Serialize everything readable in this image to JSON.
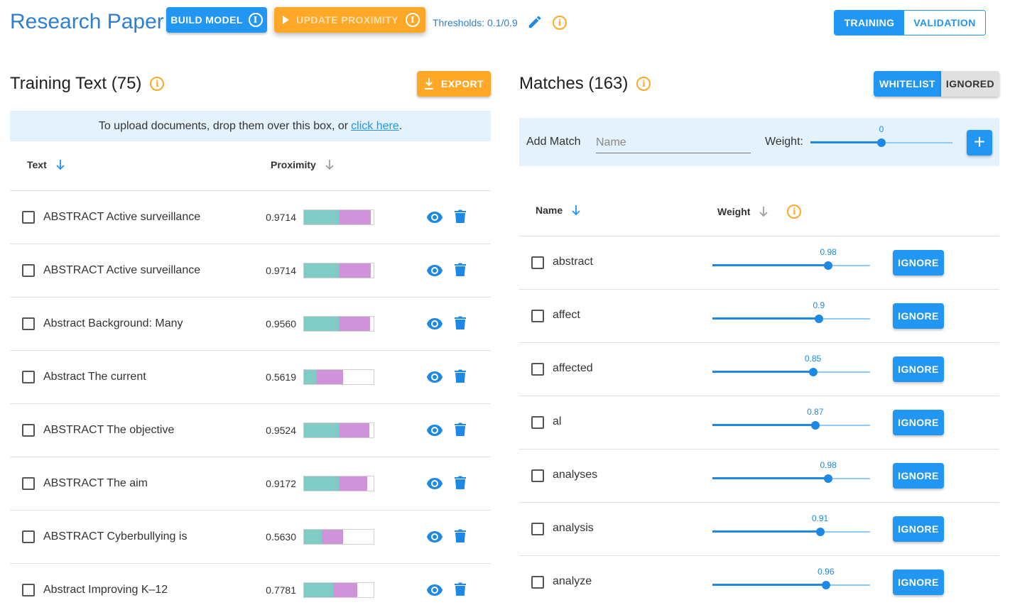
{
  "header": {
    "title": "Research Paper",
    "build_label": "BUILD MODEL",
    "update_label": "UPDATE PROXIMITY",
    "thresholds": "Thresholds: 0.1/0.9",
    "mode_tabs": [
      {
        "label": "TRAINING",
        "active": true
      },
      {
        "label": "VALIDATION",
        "active": false
      }
    ]
  },
  "colors": {
    "primary": "#2196f3",
    "accent": "#ffa726",
    "title": "#2f7fd0",
    "bar_teal": "#80cbc4",
    "bar_purple": "#ce93d8",
    "upload_bg": "#e3f2fd"
  },
  "training": {
    "title": "Training Text (75)",
    "export_label": "EXPORT",
    "upload_text": "To upload documents, drop them over this box, or",
    "upload_link": "click here",
    "upload_suffix": ".",
    "col_text": "Text",
    "col_proximity": "Proximity",
    "rows": [
      {
        "text": "ABSTRACT Active surveillance",
        "proximity": "0.9714",
        "teal": 0.5,
        "purple": 0.46
      },
      {
        "text": "ABSTRACT Active surveillance",
        "proximity": "0.9714",
        "teal": 0.5,
        "purple": 0.46
      },
      {
        "text": "Abstract Background: Many",
        "proximity": "0.9560",
        "teal": 0.5,
        "purple": 0.45
      },
      {
        "text": "Abstract The current",
        "proximity": "0.5619",
        "teal": 0.18,
        "purple": 0.38
      },
      {
        "text": "ABSTRACT The objective",
        "proximity": "0.9524",
        "teal": 0.5,
        "purple": 0.44
      },
      {
        "text": "ABSTRACT The aim",
        "proximity": "0.9172",
        "teal": 0.5,
        "purple": 0.41
      },
      {
        "text": "ABSTRACT Cyberbullying is",
        "proximity": "0.5630",
        "teal": 0.26,
        "purple": 0.3
      },
      {
        "text": "Abstract Improving K–12",
        "proximity": "0.7781",
        "teal": 0.42,
        "purple": 0.35
      }
    ]
  },
  "matches": {
    "title": "Matches (163)",
    "whitelist_label": "WHITELIST",
    "ignored_label": "IGNORED",
    "add_label": "Add Match",
    "name_placeholder": "Name",
    "weight_label": "Weight:",
    "new_weight": 0,
    "new_weight_text": "0",
    "col_name": "Name",
    "col_weight": "Weight",
    "ignore_label": "IGNORE",
    "rows": [
      {
        "name": "abstract",
        "weight": 0.98,
        "weight_text": "0.98"
      },
      {
        "name": "affect",
        "weight": 0.9,
        "weight_text": "0.9"
      },
      {
        "name": "affected",
        "weight": 0.85,
        "weight_text": "0.85"
      },
      {
        "name": "al",
        "weight": 0.87,
        "weight_text": "0.87"
      },
      {
        "name": "analyses",
        "weight": 0.98,
        "weight_text": "0.98"
      },
      {
        "name": "analysis",
        "weight": 0.91,
        "weight_text": "0.91"
      },
      {
        "name": "analyze",
        "weight": 0.96,
        "weight_text": "0.96"
      }
    ]
  }
}
